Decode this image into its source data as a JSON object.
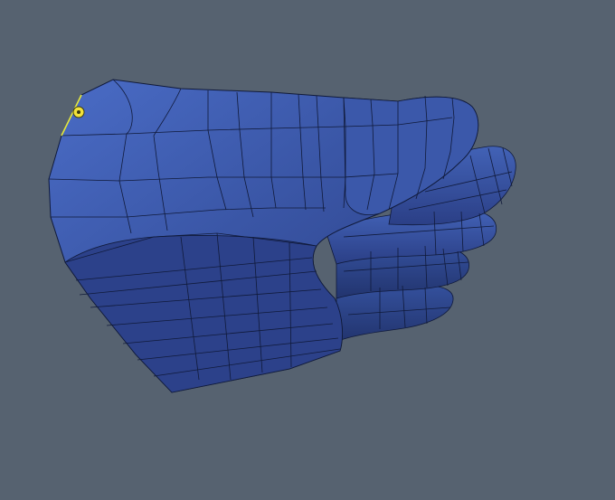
{
  "viewport": {
    "background_color": "#566270"
  },
  "model": {
    "object": "hand-mesh",
    "base_color": "#3a55a2",
    "highlight_color": "#4a6ac4",
    "shadow_color": "#27397a",
    "wire_color": "#101a3a"
  },
  "selection": {
    "edge_color": "#e5e83a",
    "vertex_color": "#f2e23a"
  }
}
